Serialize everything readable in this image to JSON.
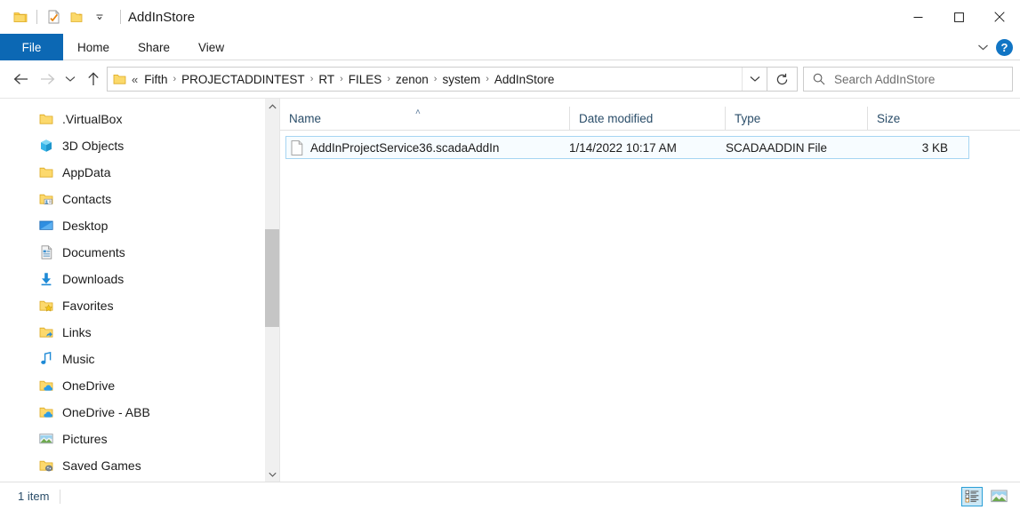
{
  "window": {
    "title": "AddInStore",
    "quick_access": [
      {
        "name": "folder-icon",
        "label": "Current folder"
      },
      {
        "name": "properties-icon",
        "label": "Properties"
      },
      {
        "name": "new-folder-icon",
        "label": "New folder"
      },
      {
        "name": "chevron-down-icon",
        "label": "Customize Quick Access Toolbar"
      }
    ],
    "controls": {
      "minimize": "—",
      "maximize": "□",
      "close": "✕"
    }
  },
  "ribbon": {
    "tabs": [
      {
        "label": "File",
        "active": true
      },
      {
        "label": "Home",
        "active": false
      },
      {
        "label": "Share",
        "active": false
      },
      {
        "label": "View",
        "active": false
      }
    ],
    "collapse_icon": "chevron-down-icon",
    "help_label": "?"
  },
  "address": {
    "back_icon": "back-arrow-icon",
    "forward_icon": "forward-arrow-icon",
    "recent_icon": "chevron-down-icon",
    "up_icon": "up-arrow-icon",
    "overflow": "«",
    "breadcrumbs": [
      "Fifth",
      "PROJECTADDINTEST",
      "RT",
      "FILES",
      "zenon",
      "system",
      "AddInStore"
    ],
    "separator": "›",
    "dropdown_icon": "chevron-down-icon",
    "refresh_icon": "refresh-icon"
  },
  "search": {
    "icon": "search-icon",
    "placeholder": "Search AddInStore",
    "value": ""
  },
  "sidebar": {
    "items": [
      {
        "label": ".VirtualBox",
        "icon": "folder-icon"
      },
      {
        "label": "3D Objects",
        "icon": "3d-objects-icon"
      },
      {
        "label": "AppData",
        "icon": "folder-icon"
      },
      {
        "label": "Contacts",
        "icon": "contacts-folder-icon"
      },
      {
        "label": "Desktop",
        "icon": "desktop-icon"
      },
      {
        "label": "Documents",
        "icon": "documents-icon"
      },
      {
        "label": "Downloads",
        "icon": "downloads-icon"
      },
      {
        "label": "Favorites",
        "icon": "favorites-folder-icon"
      },
      {
        "label": "Links",
        "icon": "links-folder-icon"
      },
      {
        "label": "Music",
        "icon": "music-icon"
      },
      {
        "label": "OneDrive",
        "icon": "onedrive-folder-icon"
      },
      {
        "label": "OneDrive - ABB",
        "icon": "onedrive-folder-icon"
      },
      {
        "label": "Pictures",
        "icon": "pictures-icon"
      },
      {
        "label": "Saved Games",
        "icon": "saved-games-folder-icon"
      }
    ],
    "scroll": {
      "up_icon": "chevron-up-icon",
      "down_icon": "chevron-down-icon"
    }
  },
  "filepane": {
    "columns": [
      {
        "key": "name",
        "label": "Name",
        "sorted": "asc",
        "sort_icon": "˄"
      },
      {
        "key": "date",
        "label": "Date modified"
      },
      {
        "key": "type",
        "label": "Type"
      },
      {
        "key": "size",
        "label": "Size"
      }
    ],
    "rows": [
      {
        "icon": "file-icon",
        "name": "AddInProjectService36.scadaAddIn",
        "date": "1/14/2022 10:17 AM",
        "type": "SCADAADDIN File",
        "size": "3 KB",
        "selected": true
      }
    ]
  },
  "statusbar": {
    "item_count": "1 item",
    "views": [
      {
        "name": "details-view-button",
        "active": true
      },
      {
        "name": "large-icons-view-button",
        "active": false
      }
    ]
  },
  "colors": {
    "accent_blue": "#0c68b4",
    "selection_border": "#a6d5f2",
    "selection_fill": "#f7fcff",
    "header_text": "#2a4d69",
    "help_blue": "#1175c4"
  }
}
